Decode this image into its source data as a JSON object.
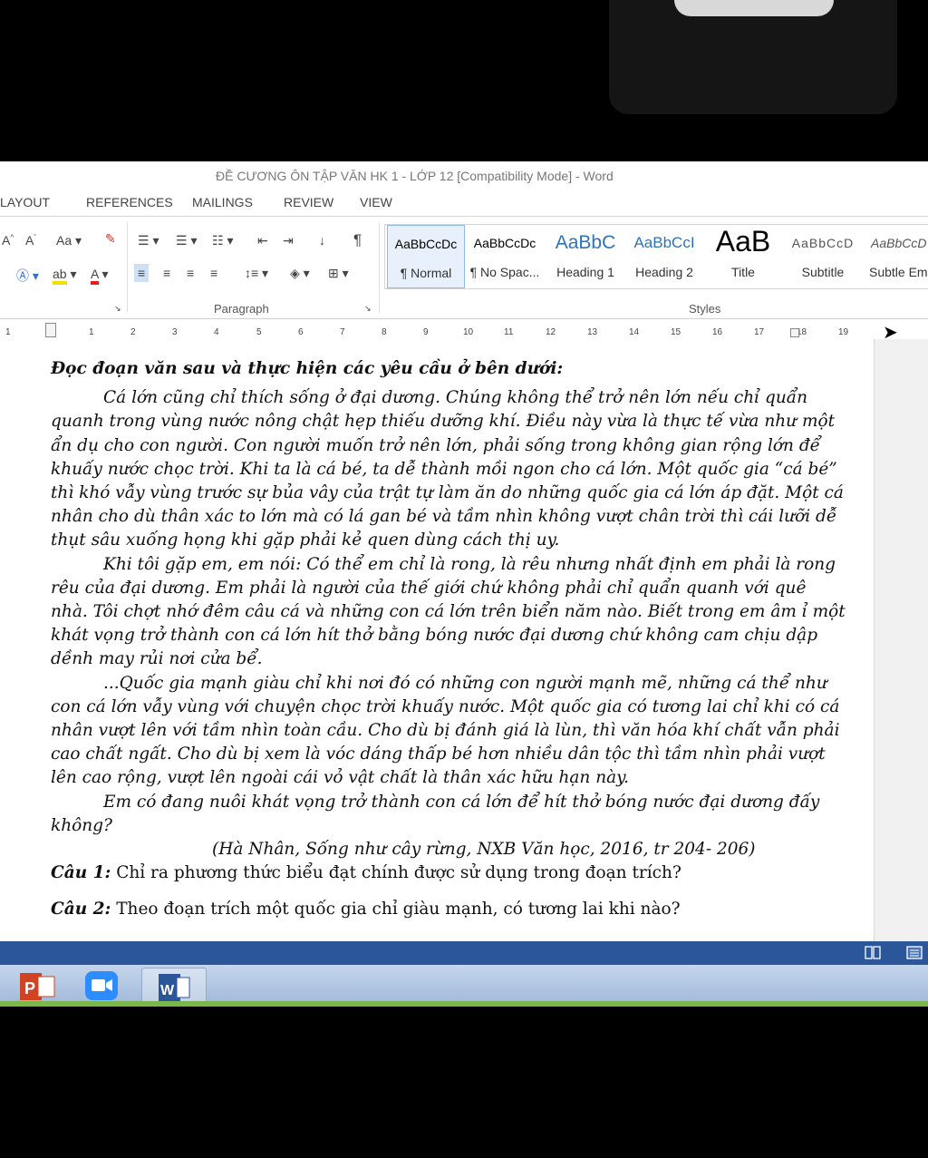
{
  "window": {
    "title": "ĐỀ CƯƠNG ÔN TẬP VĂN HK 1 - LỚP 12 [Compatibility Mode] - Word"
  },
  "tabs": [
    "LAYOUT",
    "REFERENCES",
    "MAILINGS",
    "REVIEW",
    "VIEW"
  ],
  "ribbon": {
    "font_group": {
      "aa_label": "Aa"
    },
    "paragraph_group": {
      "label": "Paragraph"
    },
    "styles_group": {
      "label": "Styles",
      "styles": [
        {
          "sample": "AaBbCcDc",
          "name": "¶ Normal",
          "selected": true
        },
        {
          "sample": "AaBbCcDc",
          "name": "¶ No Spac..."
        },
        {
          "sample": "AaBbC",
          "name": "Heading 1"
        },
        {
          "sample": "AaBbCcI",
          "name": "Heading 2"
        },
        {
          "sample": "AaB",
          "name": "Title"
        },
        {
          "sample": "AaBbCcD",
          "name": "Subtitle"
        },
        {
          "sample": "AaBbCcD",
          "name": "Subtle Em"
        }
      ]
    }
  },
  "ruler": {
    "numbers": [
      "1",
      "1",
      "2",
      "3",
      "4",
      "5",
      "6",
      "7",
      "8",
      "9",
      "10",
      "11",
      "12",
      "13",
      "14",
      "15",
      "16",
      "17",
      "18",
      "19"
    ]
  },
  "document": {
    "heading": "Đọc đoạn văn sau và thực hiện các yêu cầu ở bên dưới:",
    "para1": "Cá lớn cũng chỉ thích sống ở đại dương. Chúng không thể trở nên lớn nếu chỉ quẩn quanh trong vùng nước nông chật hẹp thiếu dưỡng khí. Điều này vừa là thực tế vừa như một ẩn dụ cho con người. Con người muốn trở nên lớn, phải sống trong không gian rộng lớn để khuấy nước chọc trời. Khi ta là cá bé, ta dễ thành mồi ngon cho cá lớn. Một quốc gia “cá bé” thì khó vẫy vùng trước sự bủa vây của trật tự làm ăn do những quốc gia cá lớn áp đặt. Một cá nhân cho dù thân xác to lớn mà có lá gan bé và tầm nhìn không vượt chân trời thì cái lưỡi dễ thụt sâu xuống họng khi gặp phải kẻ quen dùng cách thị uy.",
    "para2": "Khi tôi gặp em, em nói: Có thể em chỉ là rong, là rêu nhưng nhất định em phải là rong rêu của đại dương. Em phải là người của thế giới chứ không phải chỉ quẩn quanh với quê nhà. Tôi chợt nhớ đêm câu cá và những con cá lớn trên biển năm nào. Biết trong em âm ỉ một khát vọng trở thành con cá lớn hít thở bằng bóng nước đại dương chứ không cam chịu dập dềnh may rủi nơi cửa bể.",
    "para3": "...Quốc gia mạnh giàu chỉ khi nơi đó có những con người mạnh mẽ, những cá thể như con cá lớn vẫy vùng với chuyện chọc trời khuấy nước. Một quốc gia có tương lai chỉ khi có cá nhân vượt lên với tầm nhìn toàn cầu. Cho dù bị đánh giá là lùn, thì văn hóa khí chất vẫn phải cao chất ngất. Cho dù bị xem là vóc dáng thấp bé hơn nhiều dân tộc thì tầm nhìn phải vượt lên cao rộng, vượt lên ngoài cái vỏ vật chất là thân xác hữu hạn này.",
    "para4": "Em có đang nuôi khát vọng trở thành con cá lớn để hít thở bóng nước đại dương đấy không?",
    "source": "(Hà Nhân, Sống như cây rừng, NXB Văn học, 2016, tr 204- 206)",
    "q1_label": "Câu 1:",
    "q1_text": " Chỉ ra phương thức biểu đạt chính được sử dụng trong đoạn trích?",
    "q2_label": "Câu 2:",
    "q2_text": " Theo đoạn trích một quốc gia chỉ giàu mạnh, có tương lai khi nào?"
  },
  "taskbar": {
    "apps": [
      "powerpoint-icon",
      "zoom-icon",
      "word-icon"
    ],
    "word_letter": "W",
    "ppt_letter": "P"
  },
  "colors": {
    "statusbar": "#2b579a",
    "taskbar_accent": "#7ab648",
    "heading_style": "#2e74b5"
  }
}
